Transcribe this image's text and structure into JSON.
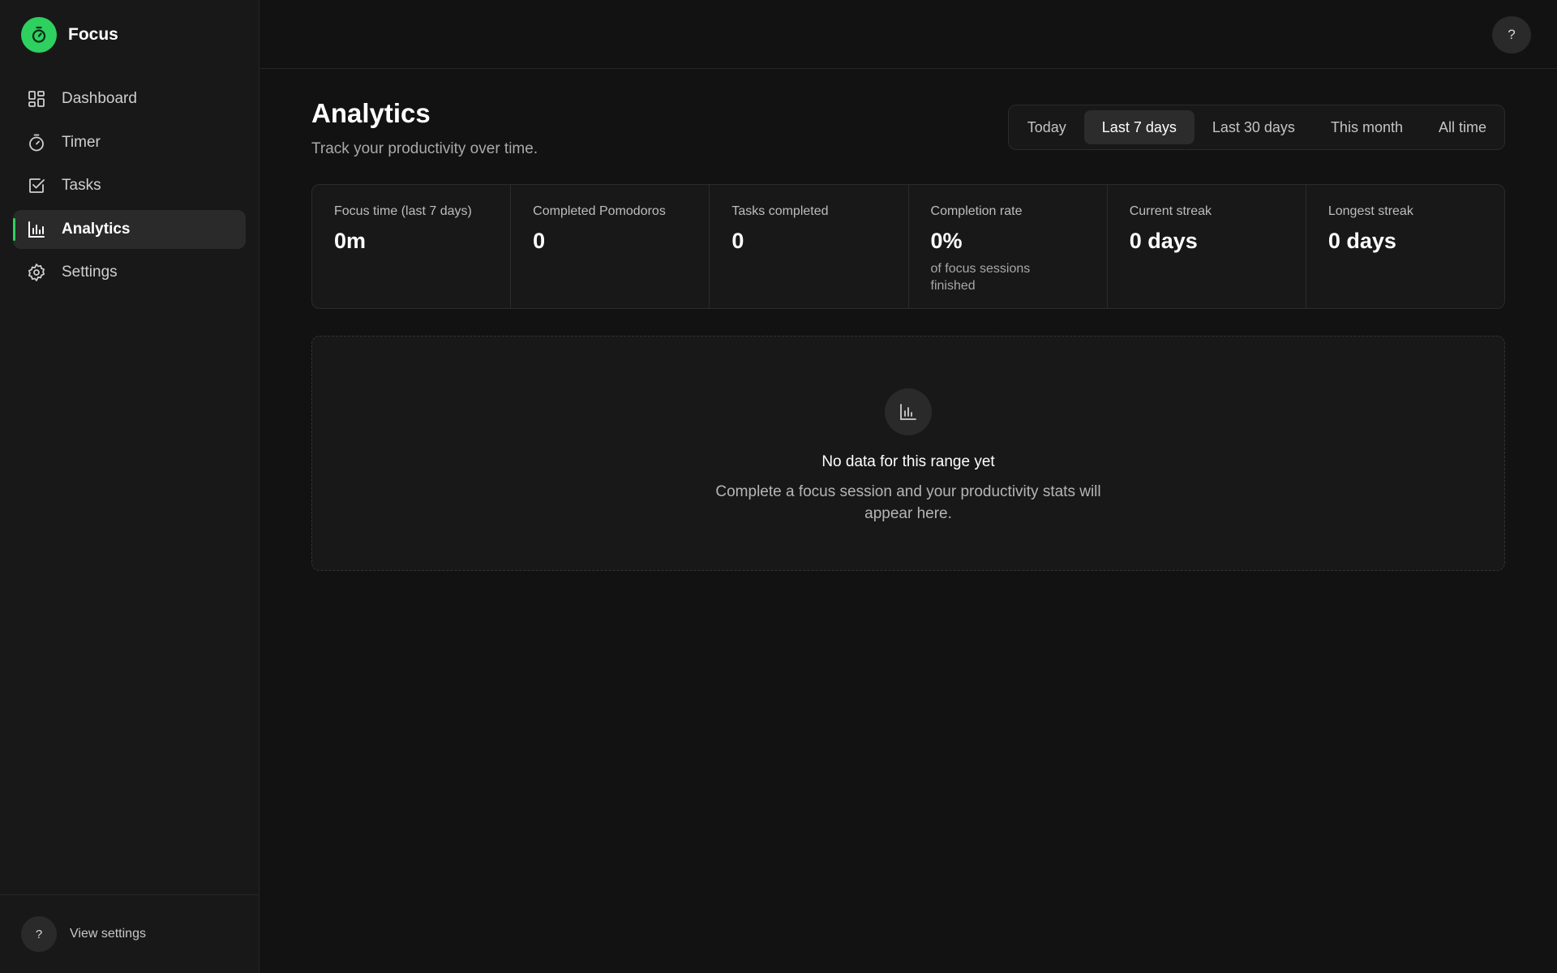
{
  "brand": {
    "name": "Focus",
    "logo_icon": "stopwatch-icon",
    "accent": "#2ed05f"
  },
  "sidebar": {
    "items": [
      {
        "label": "Dashboard",
        "icon": "dashboard-icon"
      },
      {
        "label": "Timer",
        "icon": "stopwatch-icon"
      },
      {
        "label": "Tasks",
        "icon": "checkbox-icon"
      },
      {
        "label": "Analytics",
        "icon": "bar-chart-icon",
        "active": true
      },
      {
        "label": "Settings",
        "icon": "gear-icon"
      }
    ],
    "footer": {
      "avatar": "?",
      "link": "View settings"
    }
  },
  "topbar": {
    "help": "?"
  },
  "header": {
    "title": "Analytics",
    "subtitle": "Track your productivity over time."
  },
  "range_tabs": [
    {
      "label": "Today"
    },
    {
      "label": "Last 7 days",
      "active": true
    },
    {
      "label": "Last 30 days"
    },
    {
      "label": "This month"
    },
    {
      "label": "All time"
    }
  ],
  "stats": [
    {
      "label": "Focus time (last 7 days)",
      "value": "0m"
    },
    {
      "label": "Completed Pomodoros",
      "value": "0"
    },
    {
      "label": "Tasks completed",
      "value": "0"
    },
    {
      "label": "Completion rate",
      "value": "0%",
      "note": "of focus sessions finished"
    },
    {
      "label": "Current streak",
      "value": "0 days"
    },
    {
      "label": "Longest streak",
      "value": "0 days"
    }
  ],
  "empty_state": {
    "icon": "bar-chart-icon",
    "title": "No data for this range yet",
    "description": "Complete a focus session and your productivity stats will appear here."
  }
}
